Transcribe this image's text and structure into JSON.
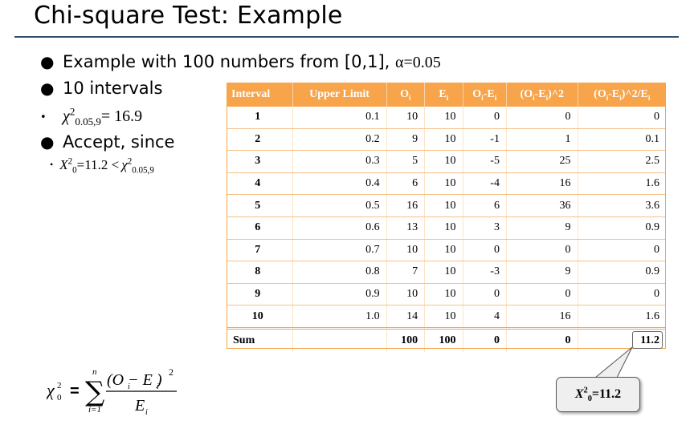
{
  "slide": {
    "title": "Chi-square Test: Example"
  },
  "bullets": {
    "b1_text": "Example with 100 numbers from [0,1], ",
    "b1_alpha": "α=0.05",
    "b2_text": "10 intervals",
    "b3_chi": "χ",
    "b3_sup": "2",
    "b3_sub": "0.05,9",
    "b3_value": "= 16.9",
    "b4_text": "Accept, since",
    "sub_x": "X",
    "sub_sup": "2",
    "sub_sub": "0",
    "sub_value": "=11.2 <",
    "sub_chi": "χ",
    "sub_chi_sup": "2",
    "sub_chi_sub": "0.05,9"
  },
  "table": {
    "headers": [
      "Interval",
      "Upper Limit",
      "O",
      "E",
      "O-E",
      "(O-E)^2",
      "(O-E)^2/E"
    ],
    "rows": [
      [
        "1",
        "0.1",
        "10",
        "10",
        "0",
        "0",
        "0"
      ],
      [
        "2",
        "0.2",
        "9",
        "10",
        "-1",
        "1",
        "0.1"
      ],
      [
        "3",
        "0.3",
        "5",
        "10",
        "-5",
        "25",
        "2.5"
      ],
      [
        "4",
        "0.4",
        "6",
        "10",
        "-4",
        "16",
        "1.6"
      ],
      [
        "5",
        "0.5",
        "16",
        "10",
        "6",
        "36",
        "3.6"
      ],
      [
        "6",
        "0.6",
        "13",
        "10",
        "3",
        "9",
        "0.9"
      ],
      [
        "7",
        "0.7",
        "10",
        "10",
        "0",
        "0",
        "0"
      ],
      [
        "8",
        "0.8",
        "7",
        "10",
        "-3",
        "9",
        "0.9"
      ],
      [
        "9",
        "0.9",
        "10",
        "10",
        "0",
        "0",
        "0"
      ],
      [
        "10",
        "1.0",
        "14",
        "10",
        "4",
        "16",
        "1.6"
      ]
    ],
    "sum": [
      "Sum",
      "",
      "100",
      "100",
      "0",
      "0",
      "11.2"
    ]
  },
  "formula": {
    "lhs": "χ",
    "lhs_sup": "2",
    "lhs_sub": "0",
    "equals": "=",
    "sigma": "∑",
    "upper": "n",
    "lower": "i=1",
    "numerator": "(O − E )",
    "num_sup": "2",
    "denominator": "E",
    "sub_i": "i"
  },
  "callout": {
    "x": "X",
    "sup": "2",
    "sub": "0",
    "value": "=11.2"
  },
  "colors": {
    "header_bg": "#f7a44a",
    "title_rule": "#2f4f6f"
  }
}
